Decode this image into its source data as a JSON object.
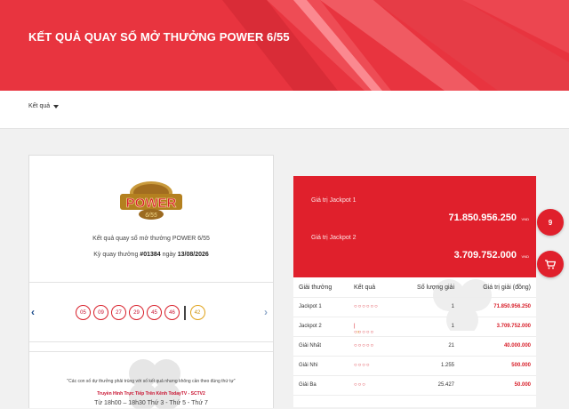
{
  "header": {
    "title": "KẾT QUẢ QUAY SỐ MỞ THƯỞNG POWER 6/55"
  },
  "subnav": {
    "results_label": "Kết quả"
  },
  "draw": {
    "logo_text": "POWER",
    "caption": "Kết quả quay số mở thưởng POWER 6/55",
    "period_prefix": "Kỳ quay thưởng",
    "period_number": "#01384",
    "date_prefix": "ngày",
    "date": "13/08/2026",
    "numbers": [
      "05",
      "09",
      "27",
      "29",
      "45",
      "46"
    ],
    "bonus": "42",
    "note": "\"Các con số dự thưởng phải trùng với số kết quả nhưng không cần theo đúng thứ tự\"",
    "broadcast": "Truyền Hình Trực Tiếp Trên Kênh TodayTV - SCTV2",
    "schedule": "Từ 18h00 – 18h30 Thứ 3 - Thứ 5 - Thứ 7"
  },
  "jackpots": {
    "jp1_label": "Giá trị Jackpot 1",
    "jp1_value": "71.850.956.250",
    "jp2_label": "Giá trị Jackpot 2",
    "jp2_value": "3.709.752.000",
    "currency": "VND"
  },
  "fab": {
    "count": "9"
  },
  "prizes": {
    "headers": [
      "Giải thưởng",
      "Kết quả",
      "Số lượng giải",
      "Giá trị giải (đồng)"
    ],
    "rows": [
      {
        "name": "Jackpot 1",
        "dots": "○○○○○○",
        "bonus_dot": "",
        "count": "1",
        "value": "71.850.956.250"
      },
      {
        "name": "Jackpot 2",
        "dots": "○○○○○",
        "bonus_dot": "○",
        "count": "1",
        "value": "3.709.752.000"
      },
      {
        "name": "Giải Nhất",
        "dots": "○○○○○",
        "bonus_dot": "",
        "count": "21",
        "value": "40.000.000"
      },
      {
        "name": "Giải Nhì",
        "dots": "○○○○",
        "bonus_dot": "",
        "count": "1.255",
        "value": "500.000"
      },
      {
        "name": "Giải Ba",
        "dots": "○○○",
        "bonus_dot": "",
        "count": "25.427",
        "value": "50.000"
      }
    ]
  },
  "colors": {
    "brand_red": "#e0202c",
    "hero_red": "#e8343f",
    "bonus_gold": "#e0a219"
  }
}
